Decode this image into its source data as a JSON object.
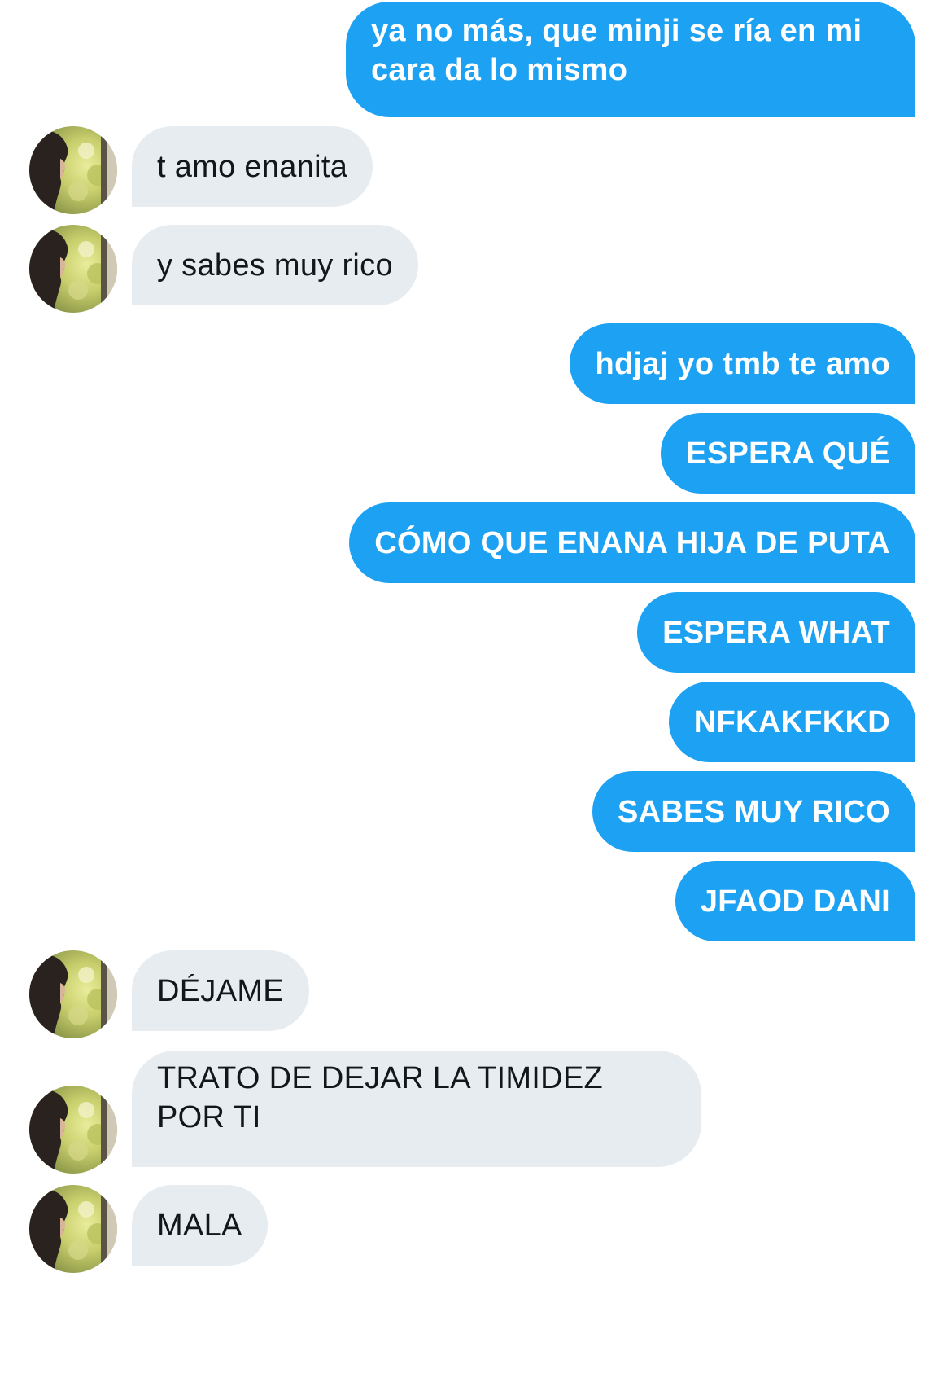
{
  "conversation": {
    "messages": [
      {
        "direction": "sent",
        "text": "ya no más, que minji se ría en mi cara da lo mismo"
      },
      {
        "direction": "received",
        "text": "t amo enanita"
      },
      {
        "direction": "received",
        "text": "y sabes muy rico"
      },
      {
        "direction": "sent",
        "text": "hdjaj yo tmb te amo"
      },
      {
        "direction": "sent",
        "text": "ESPERA QUÉ"
      },
      {
        "direction": "sent",
        "text": "CÓMO QUE ENANA HIJA DE PUTA"
      },
      {
        "direction": "sent",
        "text": "ESPERA WHAT"
      },
      {
        "direction": "sent",
        "text": "NFKAKFKKD"
      },
      {
        "direction": "sent",
        "text": "SABES MUY RICO"
      },
      {
        "direction": "sent",
        "text": "JFAOD DANI"
      },
      {
        "direction": "received",
        "text": "DÉJAME"
      },
      {
        "direction": "received",
        "text": "TRATO DE DEJAR LA TIMIDEZ POR TI"
      },
      {
        "direction": "received",
        "text": "MALA"
      }
    ]
  },
  "colors": {
    "sent_bubble": "#1da1f2",
    "sent_text": "#ffffff",
    "received_bubble": "#e6ecf0",
    "received_text": "#14171a"
  },
  "icons": {
    "avatar": "contact-profile-photo"
  }
}
